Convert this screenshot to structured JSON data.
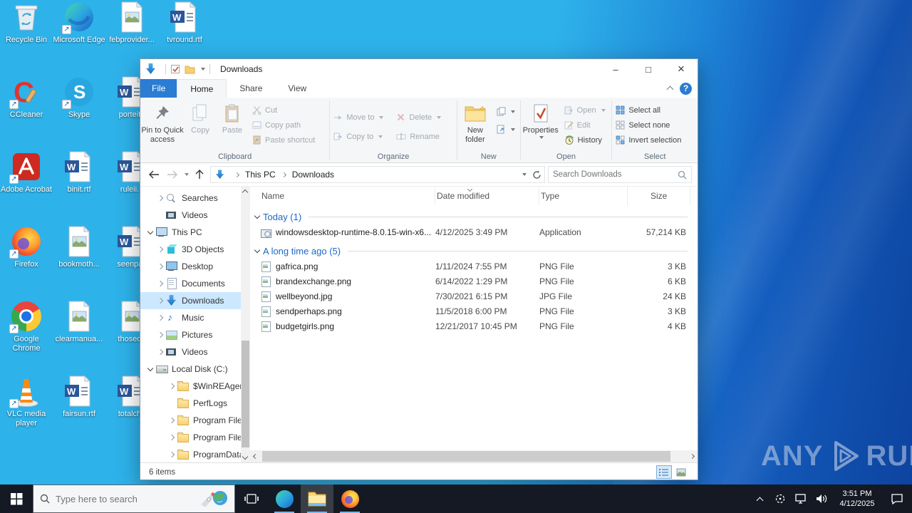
{
  "desktop": {
    "icons": [
      {
        "label": "Recycle Bin"
      },
      {
        "label": "Microsoft Edge"
      },
      {
        "label": "febprovider..."
      },
      {
        "label": "tvround.rtf"
      },
      {
        "label": "CCleaner"
      },
      {
        "label": "Skype"
      },
      {
        "label": "porteith"
      },
      {
        "label": "Adobe Acrobat"
      },
      {
        "label": "binit.rtf"
      },
      {
        "label": "ruleii..."
      },
      {
        "label": "Firefox"
      },
      {
        "label": "bookmoth..."
      },
      {
        "label": "seenpas"
      },
      {
        "label": "Google Chrome"
      },
      {
        "label": "clearmanua..."
      },
      {
        "label": "thoseda"
      },
      {
        "label": "VLC media player"
      },
      {
        "label": "fairsun.rtf"
      },
      {
        "label": "totalcha"
      }
    ]
  },
  "watermark": {
    "left": "ANY",
    "right": "RUN"
  },
  "explorer": {
    "title": "Downloads",
    "glyphs": {
      "minimize": "–",
      "maximize": "□",
      "close": "×",
      "help": "?"
    },
    "tabs": {
      "file": "File",
      "home": "Home",
      "share": "Share",
      "view": "View"
    },
    "ribbon": {
      "clipboard": {
        "label": "Clipboard",
        "pin": "Pin to Quick access",
        "copy": "Copy",
        "paste": "Paste",
        "cut": "Cut",
        "copy_path": "Copy path",
        "paste_shortcut": "Paste shortcut"
      },
      "organize": {
        "label": "Organize",
        "move_to": "Move to",
        "copy_to": "Copy to",
        "del": "Delete",
        "rename": "Rename"
      },
      "new_group": {
        "label": "New",
        "new_folder": "New folder"
      },
      "open_group": {
        "label": "Open",
        "properties": "Properties",
        "open": "Open",
        "edit": "Edit",
        "history": "History"
      },
      "select_group": {
        "label": "Select",
        "select_all": "Select all",
        "select_none": "Select none",
        "invert": "Invert selection"
      }
    },
    "address": {
      "crumb_root": "This PC",
      "crumb_current": "Downloads",
      "search_placeholder": "Search Downloads"
    },
    "nav": [
      {
        "label": "Searches",
        "icon": "search",
        "lvl": 1,
        "exp": "c"
      },
      {
        "label": "Videos",
        "icon": "videos",
        "lvl": 1,
        "exp": ""
      },
      {
        "label": "This PC",
        "icon": "pc",
        "lvl": 0,
        "exp": "e"
      },
      {
        "label": "3D Objects",
        "icon": "cube",
        "lvl": 1,
        "exp": "c"
      },
      {
        "label": "Desktop",
        "icon": "desktop",
        "lvl": 1,
        "exp": "c"
      },
      {
        "label": "Documents",
        "icon": "docs",
        "lvl": 1,
        "exp": "c"
      },
      {
        "label": "Downloads",
        "icon": "down",
        "lvl": 1,
        "exp": "c",
        "sel": true
      },
      {
        "label": "Music",
        "icon": "music",
        "lvl": 1,
        "exp": "c"
      },
      {
        "label": "Pictures",
        "icon": "pics",
        "lvl": 1,
        "exp": "c"
      },
      {
        "label": "Videos",
        "icon": "videos",
        "lvl": 1,
        "exp": "c"
      },
      {
        "label": "Local Disk (C:)",
        "icon": "disk",
        "lvl": 0,
        "exp": "e"
      },
      {
        "label": "$WinREAgent",
        "icon": "folder",
        "lvl": 2,
        "exp": "c"
      },
      {
        "label": "PerfLogs",
        "icon": "folder",
        "lvl": 2,
        "exp": ""
      },
      {
        "label": "Program Files",
        "icon": "folder",
        "lvl": 2,
        "exp": "c"
      },
      {
        "label": "Program Files",
        "icon": "folder",
        "lvl": 2,
        "exp": "c"
      },
      {
        "label": "ProgramData",
        "icon": "folder",
        "lvl": 2,
        "exp": "c"
      }
    ],
    "list": {
      "columns": {
        "name": "Name",
        "date": "Date modified",
        "type": "Type",
        "size": "Size"
      },
      "groups": [
        {
          "header": "Today (1)",
          "files": [
            {
              "icon": "app",
              "name": "windowsdesktop-runtime-8.0.15-win-x6...",
              "date": "4/12/2025 3:49 PM",
              "type": "Application",
              "size": "57,214 KB"
            }
          ]
        },
        {
          "header": "A long time ago (5)",
          "files": [
            {
              "icon": "image",
              "name": "gafrica.png",
              "date": "1/11/2024 7:55 PM",
              "type": "PNG File",
              "size": "3 KB"
            },
            {
              "icon": "image",
              "name": "brandexchange.png",
              "date": "6/14/2022 1:29 PM",
              "type": "PNG File",
              "size": "6 KB"
            },
            {
              "icon": "image",
              "name": "wellbeyond.jpg",
              "date": "7/30/2021 6:15 PM",
              "type": "JPG File",
              "size": "24 KB"
            },
            {
              "icon": "image",
              "name": "sendperhaps.png",
              "date": "11/5/2018 6:00 PM",
              "type": "PNG File",
              "size": "3 KB"
            },
            {
              "icon": "image",
              "name": "budgetgirls.png",
              "date": "12/21/2017 10:45 PM",
              "type": "PNG File",
              "size": "4 KB"
            }
          ]
        }
      ]
    },
    "status": {
      "items": "6 items"
    }
  },
  "taskbar": {
    "search_placeholder": "Type here to search",
    "clock_time": "3:51 PM",
    "clock_date": "4/12/2025"
  }
}
